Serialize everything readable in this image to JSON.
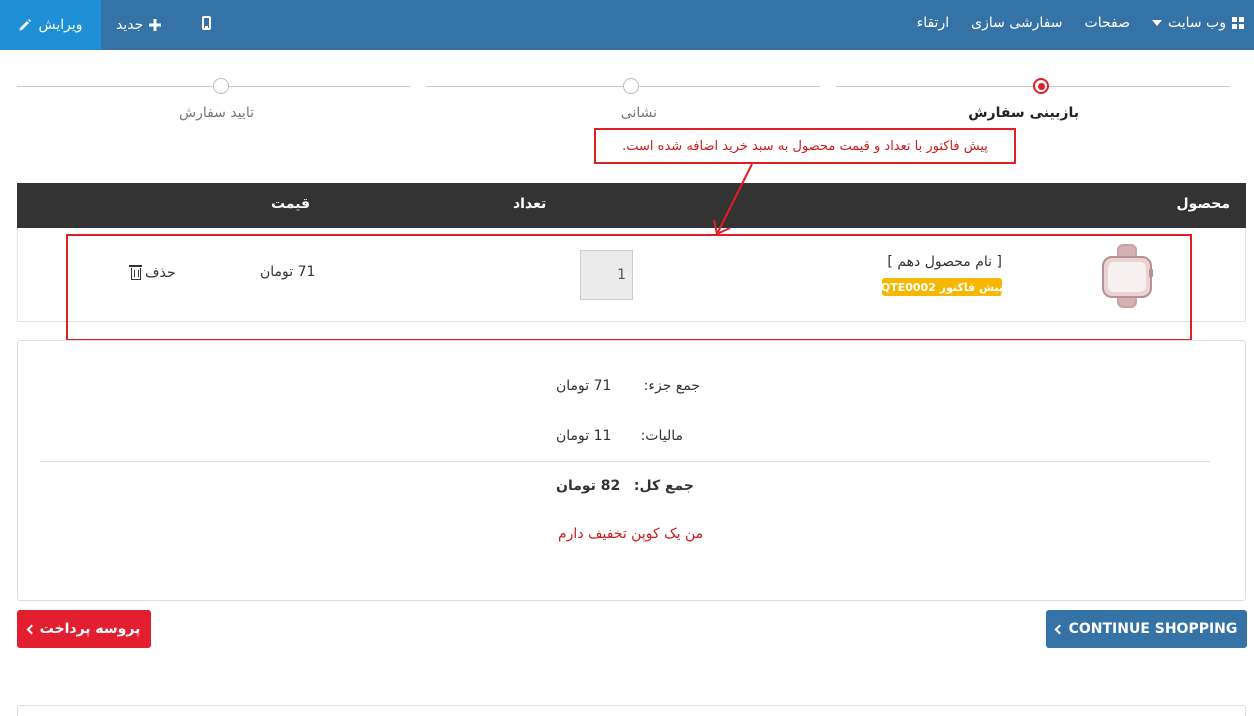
{
  "topbar": {
    "edit_label": "ویرایش",
    "new_label": "جدید",
    "nav": {
      "website": "وب سایت",
      "pages": "صفحات",
      "customize": "سفارشی سازی",
      "upgrade": "ارتقاء"
    }
  },
  "steps": [
    {
      "label": "بازبینی سفارش",
      "state": "active"
    },
    {
      "label": "نشانی",
      "state": "pending"
    },
    {
      "label": "تایید سفارش",
      "state": "pending"
    }
  ],
  "annotation": {
    "text": "پیش فاکتور با تعداد و قیمت محصول به سبد خرید اضافه شده است.",
    "color": "#e21e25"
  },
  "table": {
    "headers": {
      "product": "محصول",
      "quantity": "تعداد",
      "price": "قیمت"
    },
    "rows": [
      {
        "image_icon": "watch-product-image",
        "name": "[ نام محصول دهم ]",
        "badge": "پیش فاکتور QTE0002",
        "quantity": "1",
        "price": "71 تومان",
        "delete_label": "حذف"
      }
    ]
  },
  "totals": {
    "subtotal_label": "جمع جزء:",
    "subtotal_value": "71 تومان",
    "tax_label": "مالیات:",
    "tax_value": "11 تومان",
    "total_label": "جمع کل:",
    "total_value": "82 تومان",
    "coupon_link": "من یک کوپن تخفیف دارم"
  },
  "buttons": {
    "checkout": "پروسه پرداخت",
    "continue": "CONTINUE SHOPPING"
  },
  "colors": {
    "topbar": "#3572a6",
    "edit_button": "#1f8fd6",
    "accent_red": "#e21e2f",
    "badge": "#f7b600",
    "table_header": "#333333"
  }
}
